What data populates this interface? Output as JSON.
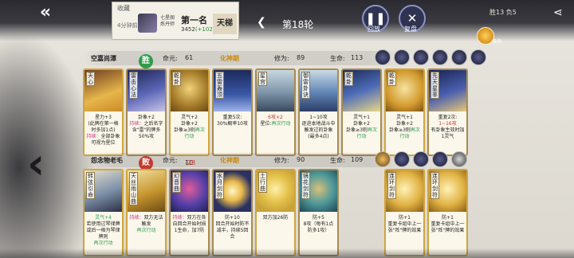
{
  "header": {
    "record_title": "收藏",
    "record_time": "4分钟前",
    "record_name": "七星阁炼丹师",
    "record_rank": "第一名",
    "record_score": "3452",
    "record_delta": "(+102)",
    "record_tier": "天梯",
    "round_label": "第18轮",
    "replay_label": "回放",
    "review_label": "复盘",
    "win_loss": "胜13 负5",
    "coin_count": "8/8"
  },
  "player1": {
    "name": "空嘉尚潭",
    "result": "胜",
    "life_label": "命元:",
    "life_value": "61",
    "realm": "化神期",
    "cultivation_label": "修为:",
    "cultivation_value": "89",
    "hp_label": "生命:",
    "hp_value": "113",
    "cards": [
      {
        "name": "天心",
        "desc_a": "星力+3",
        "desc_b": "(此牌在第一格时多加1点)",
        "desc_c": "持续：",
        "desc_d": "全部卦象可视为星位"
      },
      {
        "name": "雷击心法",
        "desc_a": "卦象+2",
        "desc_b": "持续：",
        "desc_c": "之后名字含\"雷\"的牌多50%攻"
      },
      {
        "name": "乾卦",
        "desc_a": "灵气+2",
        "desc_b": "卦象+2",
        "desc_c": "卦象≥3则",
        "desc_d": "再次行动"
      },
      {
        "name": "五雷轰顶",
        "desc_a": "重复5次:",
        "desc_b": "30%概率10攻"
      },
      {
        "name": "星宫",
        "desc_a": "6攻×2",
        "desc_b": "星位:",
        "desc_c": "再次行动"
      },
      {
        "name": "御雷卦诀",
        "desc_a": "1~10攻",
        "desc_b": "逐进本地战斗中触发过的卦象(最多4点)"
      },
      {
        "name": "乾卦",
        "desc_a": "灵气+1",
        "desc_b": "卦象+2",
        "desc_c": "卦象≥3则",
        "desc_d": "再次行动"
      },
      {
        "name": "先天星率",
        "desc_a": "重复2次:",
        "desc_b": "1~16攻",
        "desc_c": "有卦象生效时加1灵气"
      }
    ]
  },
  "player2": {
    "name": "怨念物老毛",
    "result": "败",
    "life_label": "命元:",
    "life_value": "10",
    "life_loss": "-28",
    "realm": "化神期",
    "cultivation_label": "修为:",
    "cultivation_value": "90",
    "hp_label": "生命:",
    "hp_value": "109",
    "cards": [
      {
        "name": "转弦引命",
        "desc_a": "灵气+4",
        "desc_b": "若使用过琴律牌或后一格为琴律牌则",
        "desc_c": "再次行动"
      },
      {
        "name": "天丝雨山曲",
        "desc_a": "持续：",
        "desc_b": "双方无法触发",
        "desc_c": "再次行动"
      },
      {
        "name": "幻音曲",
        "desc_a": "持续：",
        "desc_b": "双方在各自回合开始时损1生命，加7防"
      },
      {
        "name": "水月剑符",
        "desc_a": "防+10",
        "desc_b": "回合开始时防不减半，持续5回合"
      },
      {
        "name": "土行曲",
        "desc_a": "双方加26防"
      },
      {
        "name": "镜花剑符",
        "desc_a": "防+5",
        "desc_b": "8攻（每有1点防多1攻）"
      },
      {
        "name": "连环剑符",
        "desc_a": "防+1",
        "desc_b": "重复卡组中上一张\"阵\"牌的效果"
      },
      {
        "name": "连环剑符",
        "desc_a": "防+1",
        "desc_b": "重复卡组中上一张\"阵\"牌的效果"
      }
    ]
  },
  "icons": {
    "back": "arrow-left-icon",
    "replay": "pause-icon",
    "review": "close-icon",
    "share": "share-icon"
  }
}
